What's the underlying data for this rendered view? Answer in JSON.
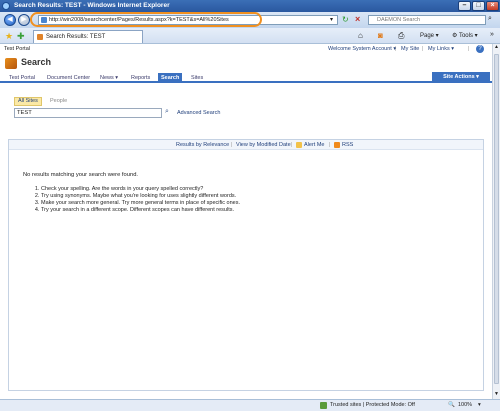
{
  "window": {
    "title": "Search Results: TEST - Windows Internet Explorer"
  },
  "address": {
    "url": "http://win2008/searchcenter/Pages/Results.aspx?k=TEST&s=All%20Sites"
  },
  "browser_search": {
    "placeholder": "DAEMON Search"
  },
  "browser_tab": {
    "label": "Search Results: TEST"
  },
  "toolbar": {
    "page_label": "Page",
    "tools_label": "Tools"
  },
  "sharepoint": {
    "portal_name": "Test Portal",
    "welcome": "Welcome System Account ▾",
    "my_site": "My Site",
    "my_links": "My Links ▾",
    "page_title": "Search",
    "nav_tabs": [
      {
        "label": "Test Portal"
      },
      {
        "label": "Document Center"
      },
      {
        "label": "News ▾"
      },
      {
        "label": "Reports"
      },
      {
        "label": "Search"
      },
      {
        "label": "Sites"
      }
    ],
    "site_actions": "Site Actions ▾",
    "scopes": {
      "all_sites": "All Sites",
      "people": "People"
    },
    "query": "TEST",
    "advanced_search": "Advanced Search",
    "results_bar": {
      "relevance": "Results by Relevance",
      "separator": "|",
      "modified": "View by Modified Date",
      "alert": "Alert Me",
      "rss": "RSS"
    },
    "no_results": "No results matching your search were found.",
    "tips": [
      "Check your spelling. Are the words in your query spelled correctly?",
      "Try using synonyms. Maybe what you're looking for uses slightly different words.",
      "Make your search more general. Try more general terms in place of specific ones.",
      "Try your search in a different scope. Different scopes can have different results."
    ]
  },
  "statusbar": {
    "zone": "Trusted sites | Protected Mode: Off",
    "zoom": "100%"
  }
}
